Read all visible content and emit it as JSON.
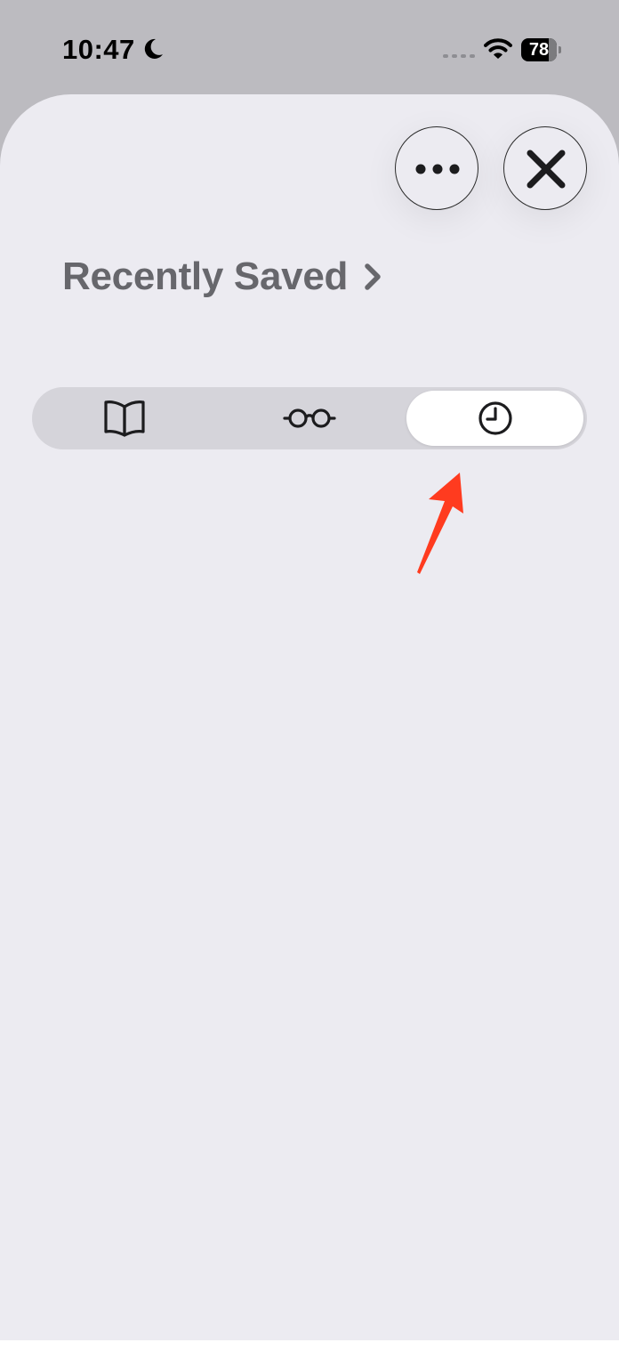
{
  "status_bar": {
    "time": "10:47",
    "battery_level": "78",
    "icons": [
      "moon-icon",
      "cellular-signal-icon",
      "wifi-icon",
      "battery-icon"
    ]
  },
  "sheet": {
    "title": "Recently Saved",
    "title_icon": "chevron-right-icon",
    "more_icon": "ellipsis-icon",
    "close_icon": "close-icon",
    "segments": [
      {
        "icon": "open-book-icon",
        "meaning": "bookmarks",
        "selected": false
      },
      {
        "icon": "glasses-icon",
        "meaning": "reading-list",
        "selected": false
      },
      {
        "icon": "clock-icon",
        "meaning": "history",
        "selected": true
      }
    ]
  },
  "annotation": {
    "arrow_color": "#ff3b1f"
  },
  "colors": {
    "backdrop": "#bcbbc0",
    "sheet_background": "#ecebf1",
    "segmented_track": "#d5d4da",
    "selected_segment": "#ffffff",
    "title_text": "#67676c"
  }
}
